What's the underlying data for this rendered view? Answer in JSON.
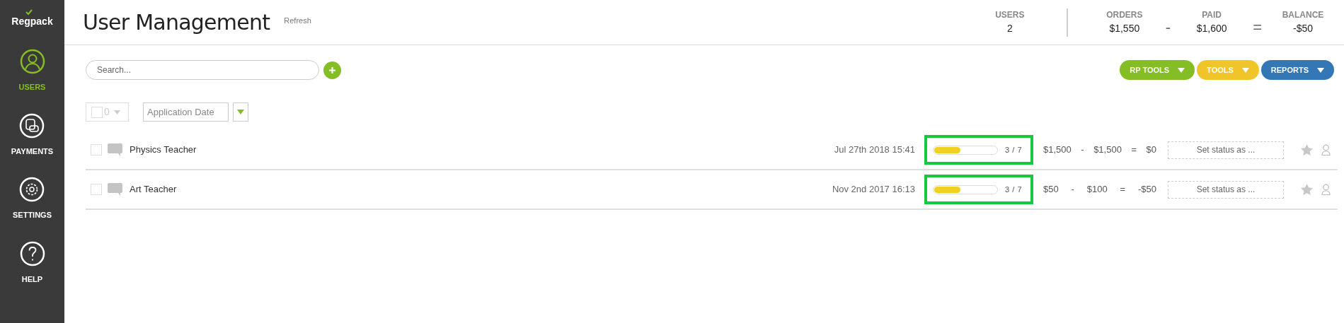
{
  "sidebar": {
    "logo": "Regpack",
    "items": [
      {
        "label": "USERS",
        "selected": true
      },
      {
        "label": "PAYMENTS",
        "selected": false
      },
      {
        "label": "SETTINGS",
        "selected": false
      },
      {
        "label": "HELP",
        "selected": false
      }
    ]
  },
  "header": {
    "title": "User Management",
    "refresh": "Refresh",
    "stats": [
      {
        "kind": "stat",
        "label": "USERS",
        "value": "2"
      },
      {
        "kind": "divider"
      },
      {
        "kind": "stat",
        "label": "ORDERS",
        "value": "$1,550"
      },
      {
        "kind": "op",
        "value": "-"
      },
      {
        "kind": "stat",
        "label": "PAID",
        "value": "$1,600"
      },
      {
        "kind": "op",
        "value": "="
      },
      {
        "kind": "stat",
        "label": "BALANCE",
        "value": "-$50"
      }
    ]
  },
  "search": {
    "placeholder": "Search..."
  },
  "tool_buttons": [
    {
      "label": "RP TOOLS",
      "color": "#84bd24"
    },
    {
      "label": "TOOLS",
      "color": "#f0c52a"
    },
    {
      "label": "REPORTS",
      "color": "#3377b5"
    }
  ],
  "filter": {
    "checked": false,
    "selected_count": "0",
    "sort_field": "Application Date"
  },
  "rows": [
    {
      "name": "Physics Teacher",
      "checked": false,
      "date": "Jul 27th 2018 15:41",
      "level": 0.42,
      "progress": "3 / 7",
      "highlighted": true,
      "orders": "$1,500",
      "op1": "-",
      "paid": "$1,500",
      "op2": "=",
      "balance": "$0",
      "status_placeholder": "Set status as ..."
    },
    {
      "name": "Art Teacher",
      "checked": false,
      "date": "Nov 2nd 2017 16:13",
      "level": 0.42,
      "progress": "3 / 7",
      "highlighted": true,
      "orders": "$50",
      "op1": "-",
      "paid": "$100",
      "op2": "=",
      "balance": "-$50",
      "status_placeholder": "Set status as ..."
    }
  ]
}
